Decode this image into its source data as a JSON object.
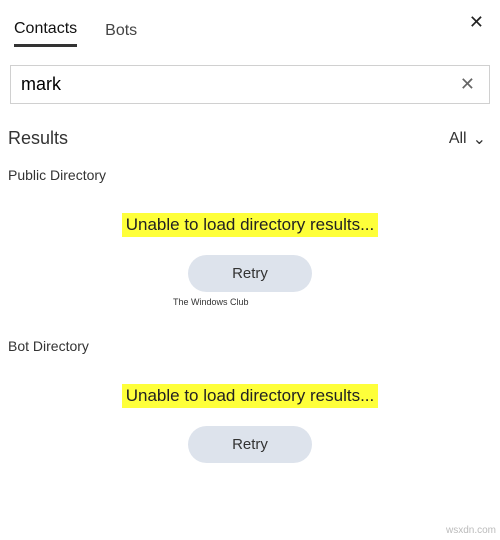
{
  "close_icon": "✕",
  "tabs": {
    "contacts": "Contacts",
    "bots": "Bots"
  },
  "search": {
    "value": "mark",
    "placeholder": "",
    "clear_icon": "✕"
  },
  "results": {
    "title": "Results",
    "filter_label": "All",
    "chevron": "⌄"
  },
  "sections": [
    {
      "label": "Public Directory",
      "error": "Unable to load directory results...",
      "retry": "Retry"
    },
    {
      "label": "Bot Directory",
      "error": "Unable to load directory results...",
      "retry": "Retry"
    }
  ],
  "watermark": "The\nWindows Club",
  "site_watermark": "wsxdn.com"
}
